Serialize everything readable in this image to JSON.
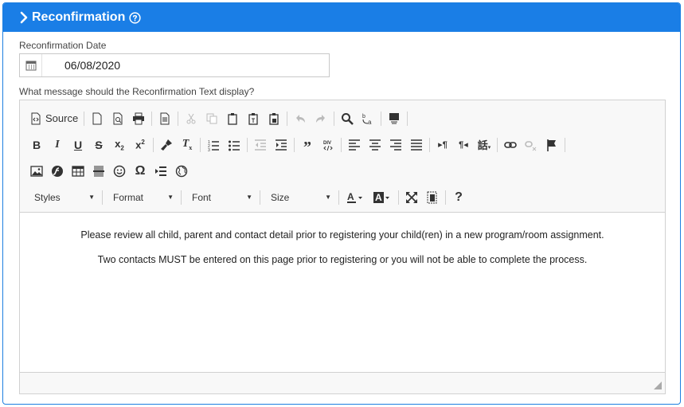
{
  "panel": {
    "title": "Reconfirmation"
  },
  "date": {
    "label": "Reconfirmation Date",
    "value": "06/08/2020"
  },
  "message": {
    "label": "What message should the Reconfirmation Text display?"
  },
  "toolbar": {
    "source_label": "Source",
    "styles_label": "Styles",
    "format_label": "Format",
    "font_label": "Font",
    "size_label": "Size"
  },
  "content": {
    "paragraphs": [
      "Please review all child, parent and contact detail prior to registering your child(ren) in a new program/room assignment.",
      "Two contacts MUST be entered on this page prior to registering or you will not be able to complete the process."
    ]
  },
  "colors": {
    "header": "#1a7ee6",
    "border": "#1d7fe0"
  },
  "icons": [
    "chevron-right-icon",
    "help-circle-icon",
    "calendar-icon"
  ]
}
